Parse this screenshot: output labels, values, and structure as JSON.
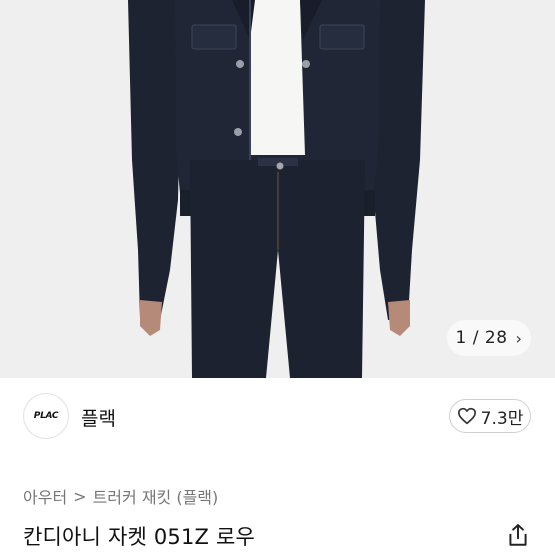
{
  "gallery": {
    "counter": "1 / 28",
    "next_icon": "chevron-right-icon"
  },
  "brand": {
    "logo_text": "PLAC",
    "name": "플랙"
  },
  "like": {
    "icon": "heart-outline-icon",
    "count": "7.3만"
  },
  "breadcrumb": {
    "items": [
      "아우터",
      "트러커 재킷 (플랙)"
    ],
    "separator": ">"
  },
  "product": {
    "title": "칸디아니 자켓 051Z 로우"
  },
  "share": {
    "icon": "share-icon"
  },
  "colors": {
    "denim": "#1c2230",
    "background": "#eeeeee",
    "text": "#111111"
  }
}
